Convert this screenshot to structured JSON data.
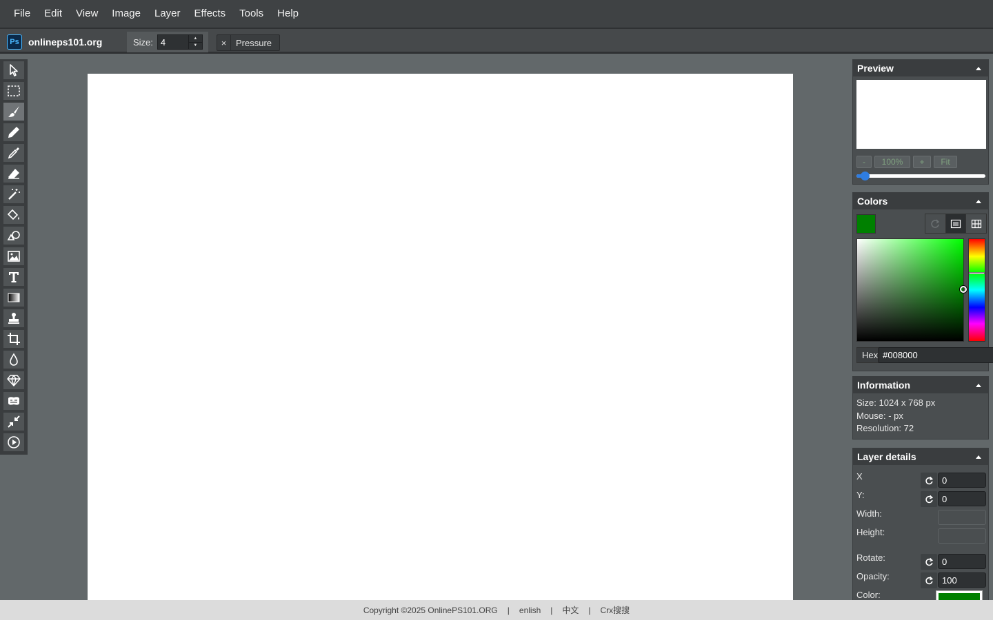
{
  "menu": [
    "File",
    "Edit",
    "View",
    "Image",
    "Layer",
    "Effects",
    "Tools",
    "Help"
  ],
  "brand": {
    "logo": "Ps",
    "name": "onlineps101.org"
  },
  "toolbar": {
    "size_label": "Size:",
    "size_value": "4",
    "pressure_label": "Pressure",
    "pressure_close": "×"
  },
  "tools": [
    {
      "name": "select-tool-icon",
      "active": false
    },
    {
      "name": "rectangle-select-icon",
      "active": false
    },
    {
      "name": "brush-icon",
      "active": true
    },
    {
      "name": "pencil-icon",
      "active": false
    },
    {
      "name": "color-picker-icon",
      "active": false
    },
    {
      "name": "eraser-icon",
      "active": false
    },
    {
      "name": "magic-wand-icon",
      "active": false
    },
    {
      "name": "fill-bucket-icon",
      "active": false
    },
    {
      "name": "shapes-icon",
      "active": false
    },
    {
      "name": "image-icon",
      "active": false
    },
    {
      "name": "text-icon",
      "active": false
    },
    {
      "name": "gradient-icon",
      "active": false
    },
    {
      "name": "clone-stamp-icon",
      "active": false
    },
    {
      "name": "crop-icon",
      "active": false
    },
    {
      "name": "blur-icon",
      "active": false
    },
    {
      "name": "sharpen-icon",
      "active": false
    },
    {
      "name": "bulge-icon",
      "active": false
    },
    {
      "name": "resize-icon",
      "active": false
    },
    {
      "name": "animation-icon",
      "active": false
    }
  ],
  "preview": {
    "title": "Preview",
    "zoom_out": "-",
    "zoom_value": "100%",
    "zoom_in": "+",
    "fit": "Fit",
    "zoom_fraction": 0.03
  },
  "colors": {
    "title": "Colors",
    "current": "#008000",
    "hex_label": "Hex",
    "hex_value": "#008000"
  },
  "information": {
    "title": "Information",
    "size": "Size: 1024 x 768 px",
    "mouse": "Mouse: - px",
    "resolution": "Resolution: 72"
  },
  "layer_details": {
    "title": "Layer details",
    "x_label": "X",
    "x_value": "0",
    "y_label": "Y:",
    "y_value": "0",
    "width_label": "Width:",
    "width_value": "",
    "height_label": "Height:",
    "height_value": "",
    "rotate_label": "Rotate:",
    "rotate_value": "0",
    "opacity_label": "Opacity:",
    "opacity_value": "100",
    "color_label": "Color:",
    "color_value": "#008000"
  },
  "footer": {
    "copyright": "Copyright ©2025 OnlinePS101.ORG",
    "sep": "|",
    "lang_en": "enlish",
    "lang_zh": "中文",
    "crx": "Crx搜搜"
  }
}
